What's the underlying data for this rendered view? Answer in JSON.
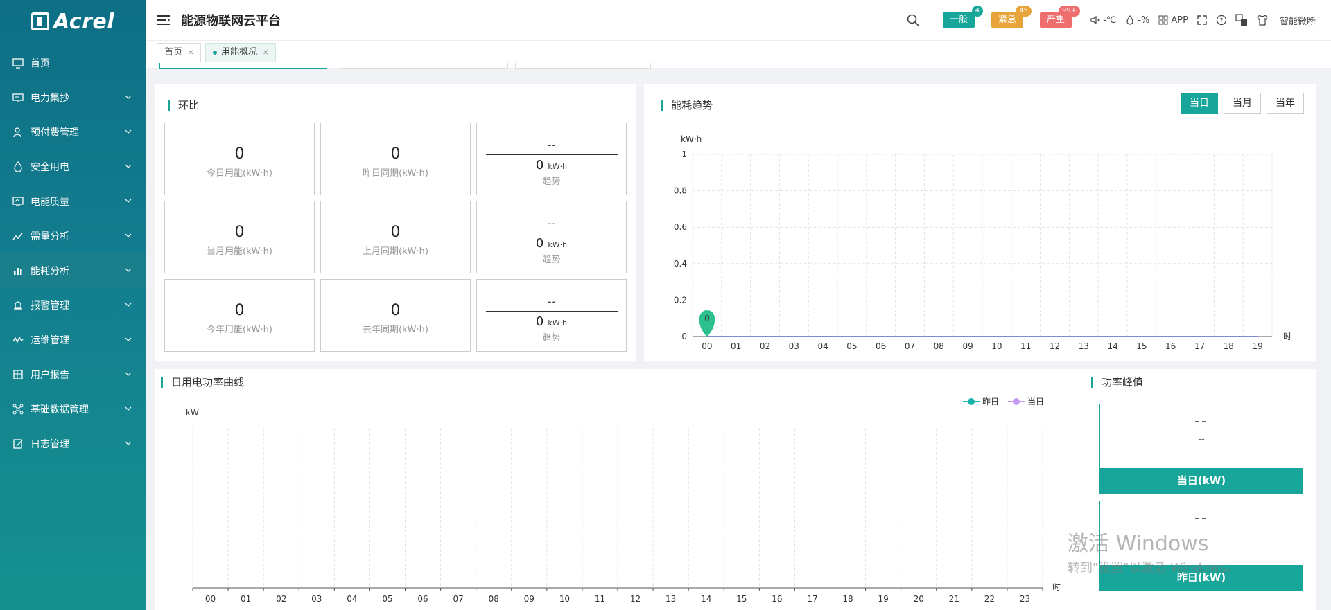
{
  "brand": {
    "logo_text": "Acrel",
    "app_title": "能源物联网云平台"
  },
  "sidebar": {
    "items": [
      {
        "label": "首页",
        "icon": "monitor-icon"
      },
      {
        "label": "电力集抄",
        "icon": "meter-icon"
      },
      {
        "label": "预付费管理",
        "icon": "user-icon"
      },
      {
        "label": "安全用电",
        "icon": "flame-icon"
      },
      {
        "label": "电能质量",
        "icon": "screen-icon"
      },
      {
        "label": "需量分析",
        "icon": "trend-icon"
      },
      {
        "label": "能耗分析",
        "icon": "bar-chart-icon"
      },
      {
        "label": "报警管理",
        "icon": "alarm-icon"
      },
      {
        "label": "运维管理",
        "icon": "wave-icon"
      },
      {
        "label": "用户报告",
        "icon": "report-icon"
      },
      {
        "label": "基础数据管理",
        "icon": "network-icon"
      },
      {
        "label": "日志管理",
        "icon": "log-icon"
      }
    ]
  },
  "header": {
    "alerts": [
      {
        "label": "一般",
        "count": "4",
        "color": "#19a69a",
        "count_color": "#19a69a"
      },
      {
        "label": "紧急",
        "count": "45",
        "color": "#e8a43a",
        "count_color": "#e8a43a"
      },
      {
        "label": "严重",
        "count": "99+",
        "color": "#ee6d6d",
        "count_color": "#ee6d6d"
      }
    ],
    "temperature": "-℃",
    "humidity": "-%",
    "app_label": "APP",
    "diagnosis_label": "智能微断"
  },
  "tabs": [
    {
      "label": "首页"
    },
    {
      "label": "用能概况"
    }
  ],
  "ratio_panel": {
    "title": "环比",
    "rows": [
      {
        "current_value": "0",
        "current_label": "今日用能(kW·h)",
        "prev_value": "0",
        "prev_label": "昨日同期(kW·h)",
        "trend_value": "--",
        "trend_amount": "0",
        "trend_unit": "kW·h",
        "trend_label": "趋势"
      },
      {
        "current_value": "0",
        "current_label": "当月用能(kW·h)",
        "prev_value": "0",
        "prev_label": "上月同期(kW·h)",
        "trend_value": "--",
        "trend_amount": "0",
        "trend_unit": "kW·h",
        "trend_label": "趋势"
      },
      {
        "current_value": "0",
        "current_label": "今年用能(kW·h)",
        "prev_value": "0",
        "prev_label": "去年同期(kW·h)",
        "trend_value": "--",
        "trend_amount": "0",
        "trend_unit": "kW·h",
        "trend_label": "趋势"
      }
    ]
  },
  "trend_panel": {
    "title": "能耗趋势",
    "buttons": {
      "day": "当日",
      "month": "当月",
      "year": "当年"
    }
  },
  "power_panel": {
    "title": "日用电功率曲线"
  },
  "peak_panel": {
    "title": "功率峰值",
    "today": {
      "value": "--",
      "time": "--",
      "label": "当日(kW)"
    },
    "yesterday": {
      "value": "--",
      "label": "昨日(kW)"
    }
  },
  "watermark": {
    "line1": "激活 Windows",
    "line2": "转到\"设置\"以激活 Windows。"
  },
  "chart_data": [
    {
      "type": "line",
      "ylabel": "kW·h",
      "xlabel": "时",
      "ylim": [
        0,
        1
      ],
      "yticks": [
        0,
        0.2,
        0.4,
        0.6,
        0.8,
        1
      ],
      "x": [
        "00",
        "01",
        "02",
        "03",
        "04",
        "05",
        "06",
        "07",
        "08",
        "09",
        "10",
        "11",
        "12",
        "13",
        "14",
        "15",
        "16",
        "17",
        "18",
        "19"
      ],
      "series": [
        {
          "values": [
            0,
            0,
            0,
            0,
            0,
            0,
            0,
            0,
            0,
            0,
            0,
            0,
            0,
            0,
            0,
            0,
            0,
            0,
            0,
            0
          ]
        }
      ],
      "marker": {
        "x": "00",
        "value": "0"
      },
      "grid": true
    },
    {
      "type": "line",
      "ylabel": "kW",
      "xlabel": "时",
      "x": [
        "00",
        "01",
        "02",
        "03",
        "04",
        "05",
        "06",
        "07",
        "08",
        "09",
        "10",
        "11",
        "12",
        "13",
        "14",
        "15",
        "16",
        "17",
        "18",
        "19",
        "20",
        "21",
        "22",
        "23"
      ],
      "series": [
        {
          "name": "昨日",
          "values": [],
          "color": "#19b5ad"
        },
        {
          "name": "当日",
          "values": [],
          "color": "#c69cf0"
        }
      ],
      "legend": "top-right",
      "grid": true
    }
  ]
}
